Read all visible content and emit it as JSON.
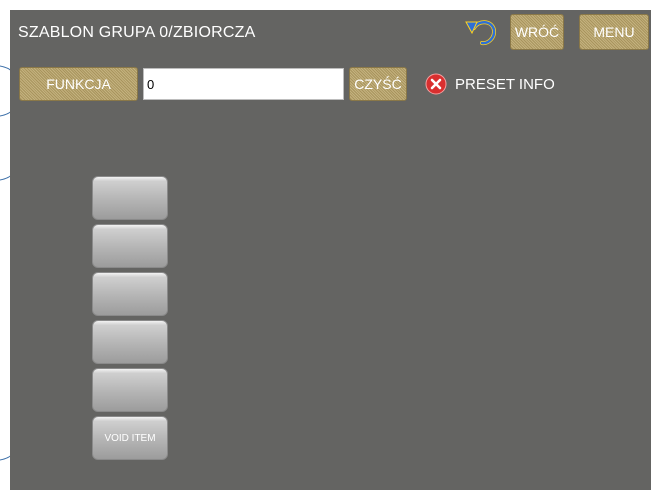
{
  "header": {
    "title": "SZABLON GRUPA 0/ZBIORCZA",
    "undo_icon": "undo-arrow-icon",
    "back_label": "WRÓĆ",
    "menu_label": "MENU"
  },
  "function_row": {
    "function_label": "FUNKCJA",
    "input_value": "0",
    "clear_label": "CZYŚĆ"
  },
  "preset": {
    "icon": "red-x-icon",
    "label": "PRESET INFO"
  },
  "keys": [
    {
      "label": ""
    },
    {
      "label": ""
    },
    {
      "label": ""
    },
    {
      "label": ""
    },
    {
      "label": ""
    },
    {
      "label": "VOID ITEM"
    }
  ],
  "colors": {
    "background": "#646462",
    "gold_button": "#b7a46e",
    "key_gray": "#b4b4b4",
    "close_red": "#d92f2f"
  }
}
